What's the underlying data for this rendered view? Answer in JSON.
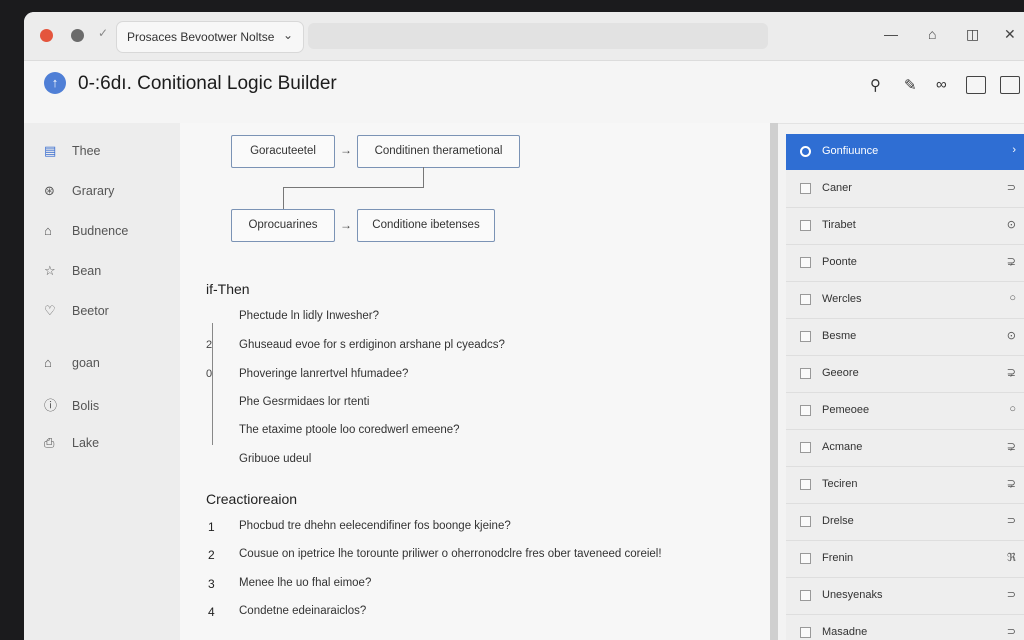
{
  "window": {
    "tab_label": "Prosaces Bevootwer Noltse",
    "tab_chevron": "⌄",
    "controls": {
      "minimize": "—",
      "home": "⌂",
      "restore": "◫",
      "close": "✕"
    }
  },
  "header": {
    "logo_glyph": "↑",
    "title": "0-:6dı. Conitional Logic Builder",
    "icons": [
      "filter-icon",
      "edit-icon",
      "link-icon",
      "panel-icon",
      "collapse-icon"
    ]
  },
  "sidebar": {
    "items": [
      {
        "label": "Thee",
        "icon": "bookmark-icon"
      },
      {
        "label": "Grarary",
        "icon": "compass-icon"
      },
      {
        "label": "Budnence",
        "icon": "home-icon"
      },
      {
        "label": "Bean",
        "icon": "star-icon"
      },
      {
        "label": "Beetor",
        "icon": "heart-icon"
      },
      {
        "label": "goan",
        "icon": "house-icon"
      },
      {
        "label": "Bolis",
        "icon": "info-icon"
      },
      {
        "label": "Lake",
        "icon": "document-icon"
      }
    ]
  },
  "flow": {
    "nodes": [
      "Goracuteetel",
      "Conditinen therametional",
      "Oprocuarines",
      "Conditione ibetenses"
    ]
  },
  "if_then": {
    "title": "if-Then",
    "markers": [
      "2",
      "0"
    ],
    "steps": [
      "Phectude ln lidly Inwesher?",
      "Ghuseaud evoe for s erdiginon arshane pl cyeadcs?",
      "Phoveringe lanrertvel hfumadee?",
      "Phe Gesrmidaes lor rtenti",
      "The etaxime ptoole loo coredwerl emeene?",
      "Gribuoe udeul"
    ]
  },
  "creation": {
    "title": "Creactioreaion",
    "steps": [
      {
        "num": "1",
        "text": "Phocbud tre dhehn eelecendifiner fos boonge kjeine?"
      },
      {
        "num": "2",
        "text": "Cousue on ipetrice lhe torounte priliwer o oherronodclre fres ober taveneed coreiel!"
      },
      {
        "num": "3",
        "text": "Menee lhe uo fhal eimoe?"
      },
      {
        "num": "4",
        "text": "Condetne edeinaraiclos?"
      }
    ]
  },
  "right_panel": {
    "items": [
      {
        "label": "Gonfiuunce",
        "arrow": "›",
        "active": true
      },
      {
        "label": "Caner",
        "arrow": "⊃",
        "active": false
      },
      {
        "label": "Tirabet",
        "arrow": "⊙",
        "active": false
      },
      {
        "label": "Poonte",
        "arrow": "⊋",
        "active": false
      },
      {
        "label": "Wercles",
        "arrow": "○",
        "active": false
      },
      {
        "label": "Besme",
        "arrow": "⊙",
        "active": false
      },
      {
        "label": "Geeore",
        "arrow": "⊋",
        "active": false
      },
      {
        "label": "Pemeoee",
        "arrow": "○",
        "active": false
      },
      {
        "label": "Acmane",
        "arrow": "⊋",
        "active": false
      },
      {
        "label": "Teciren",
        "arrow": "⊋",
        "active": false
      },
      {
        "label": "Drelse",
        "arrow": "⊃",
        "active": false
      },
      {
        "label": "Frenin",
        "arrow": "ℜ",
        "active": false
      },
      {
        "label": "Unesyenaks",
        "arrow": "⊃",
        "active": false
      },
      {
        "label": "Masadne",
        "arrow": "⊃",
        "active": false
      }
    ]
  }
}
